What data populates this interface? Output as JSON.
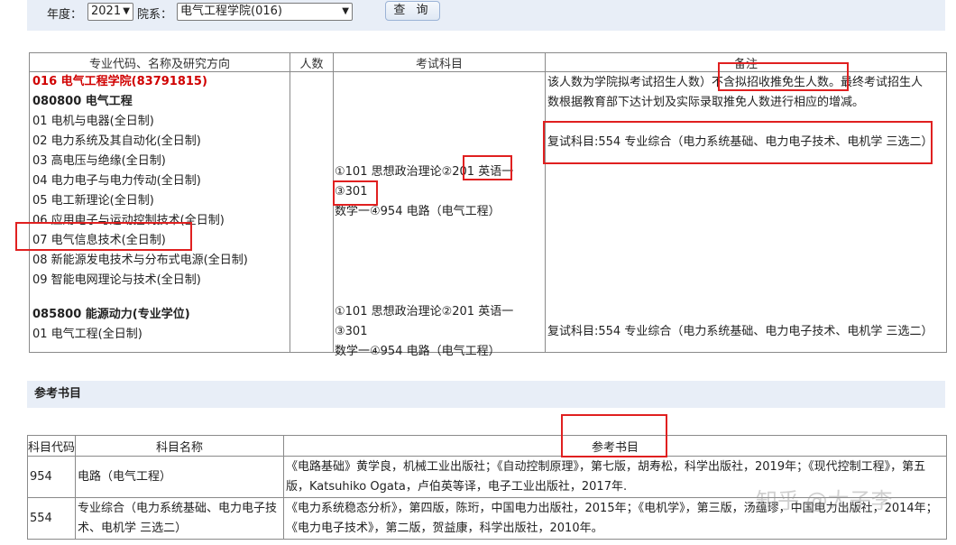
{
  "filter": {
    "year_label": "年度：",
    "year_value": "2021",
    "dept_label": "院系：",
    "dept_value": "电气工程学院(016)",
    "query_button": "查 询"
  },
  "table": {
    "headers": [
      "专业代码、名称及研究方向",
      "人数",
      "考试科目",
      "备注"
    ],
    "college": "016 电气工程学院(83791815)",
    "major1": {
      "title": "080800 电气工程",
      "directions": [
        "01 电机与电器(全日制)",
        "02 电力系统及其自动化(全日制)",
        "03 高电压与绝缘(全日制)",
        "04 电力电子与电力传动(全日制)",
        "05 电工新理论(全日制)",
        "06 应用电子与运动控制技术(全日制)",
        "07 电气信息技术(全日制)",
        "08 新能源发电技术与分布式电源(全日制)",
        "09 智能电网理论与技术(全日制)"
      ],
      "exam_line1": "①101 思想政治理论②201 英语一③301",
      "exam_line2": "数学一④954 电路（电气工程）",
      "note_line1": "该人数为学院拟考试招生人数）不含拟招收推免生人数。最终考试招生人",
      "note_line2": "数根据教育部下达计划及实际录取推免人数进行相应的增减。",
      "note_line3": "复试科目:554 专业综合（电力系统基础、电力电子技术、电机学 三选二）"
    },
    "major2": {
      "title": "085800 能源动力(专业学位)",
      "directions": [
        "01 电气工程(全日制)"
      ],
      "exam_line1": "①101 思想政治理论②201 英语一③301",
      "exam_line2": "数学一④954 电路（电气工程）",
      "note": "复试科目:554 专业综合（电力系统基础、电力电子技术、电机学 三选二）"
    }
  },
  "books": {
    "section_title": "参考书目",
    "headers": [
      "科目代码",
      "科目名称",
      "参考书目"
    ],
    "rows": [
      {
        "code": "954",
        "name": "电路（电气工程）",
        "ref_line1": "《电路基础》黄学良，机械工业出版社；《自动控制原理》，第七版，胡寿松，科学出版社，2019年；《现代控制工程》，第五",
        "ref_line2": "版，Katsuhiko Ogata，卢伯英等译，电子工业出版社，2017年."
      },
      {
        "code": "554",
        "name_line1": "专业综合（电力系统基础、电力电子技",
        "name_line2": "术、电机学 三选二）",
        "ref_line1": "《电力系统稳态分析》，第四版，陈珩，中国电力出版社，2015年；《电机学》，第三版，汤蕴璆，中国电力出版社，2014年；",
        "ref_line2": "《电力电子技术》，第二版，贺益康，科学出版社，2010年。"
      }
    ]
  },
  "watermark": "知乎 @大子李",
  "colors": {
    "highlight": "#e02020",
    "college": "#d00000",
    "band": "#e8eef7"
  }
}
